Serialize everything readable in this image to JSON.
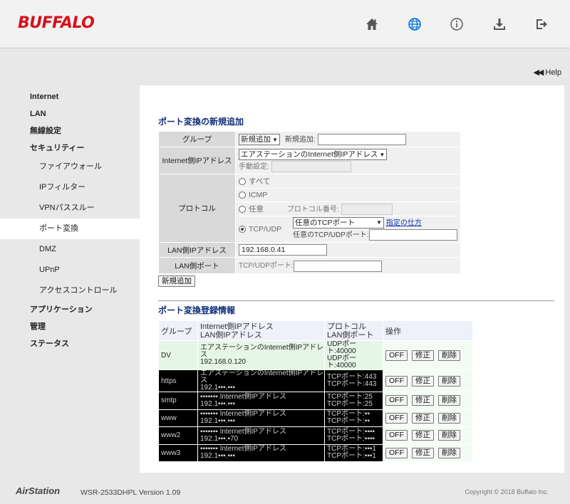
{
  "header": {
    "logo": "BUFFALO",
    "icons": [
      "home-icon",
      "globe-icon",
      "info-icon",
      "download-icon",
      "logout-icon"
    ],
    "active_icon_color": "#1a7fd6",
    "brand_color": "#d6111b"
  },
  "help": {
    "arrows": "◀◀",
    "label": "Help"
  },
  "sidebar": {
    "internet": "Internet",
    "lan": "LAN",
    "wireless": "無線設定",
    "security": "セキュリティー",
    "firewall": "ファイアウォール",
    "ipfilter": "IPフィルター",
    "vpn": "VPNパススルー",
    "portforward": "ポート変換",
    "dmz": "DMZ",
    "upnp": "UPnP",
    "access": "アクセスコントロール",
    "application": "アプリケーション",
    "admin": "管理",
    "status": "ステータス"
  },
  "add_section": {
    "title": "ポート変換の新規追加",
    "group_label": "グループ",
    "group_select": "新規追加",
    "group_new_label": "新規追加:",
    "internet_ip_label": "Internet側IPアドレス",
    "internet_ip_select": "エアステーションのInternet側IPアドレス",
    "manual_label": "手動設定:",
    "protocol_label": "プロトコル",
    "proto_all": "すべて",
    "proto_icmp": "ICMP",
    "proto_any": "任意",
    "proto_number_label": "プロトコル番号:",
    "proto_tcpudp": "TCP/UDP",
    "tcp_select": "任意のTCPポート",
    "howto_link": "指定の仕方",
    "any_port_label": "任意のTCP/UDPポート:",
    "lan_ip_label": "LAN側IPアドレス",
    "lan_ip_value": "192.168.0.41",
    "lan_port_label": "LAN側ポート",
    "lan_port_prefix": "TCP/UDPポート:",
    "add_button": "新規追加"
  },
  "list_section": {
    "title": "ポート変換登録情報",
    "headers": {
      "group": "グループ",
      "addr1": "Internet側IPアドレス",
      "addr2": "LAN側IPアドレス",
      "proto1": "プロトコル",
      "proto2": "LAN側ポート",
      "ops": "操作"
    },
    "rows": [
      {
        "group": "DV",
        "addr1": "エアステーションのInternet側IPアドレス",
        "addr2": "192.168.0.120",
        "proto1": "UDPポート:40000",
        "proto2": "UDPポート:40000",
        "style": "green"
      },
      {
        "group": "https",
        "addr1": "エアステーションのInternet側IPアドレス",
        "addr2": "192.1▪▪▪.▪▪▪",
        "proto1": "TCPポート:443",
        "proto2": "TCPポート:443",
        "style": "dark"
      },
      {
        "group": "smtp",
        "addr1": "▪▪▪▪▪▪▪ Internet側IPアドレス",
        "addr2": "192.1▪▪▪.▪▪▪",
        "proto1": "TCPポート:25",
        "proto2": "TCPポート:25",
        "style": "dark"
      },
      {
        "group": "www",
        "addr1": "▪▪▪▪▪▪▪ Internet側IPアドレス",
        "addr2": "192.1▪▪▪.▪▪▪",
        "proto1": "TCPポート:▪▪",
        "proto2": "TCPポート:▪▪",
        "style": "dark"
      },
      {
        "group": "www2",
        "addr1": "▪▪▪▪▪▪▪ Internet側IPアドレス",
        "addr2": "192.1▪▪▪.▪70",
        "proto1": "TCPポート:▪▪▪▪",
        "proto2": "TCPポート:▪▪▪▪",
        "style": "dark"
      },
      {
        "group": "www3",
        "addr1": "▪▪▪▪▪▪▪ Internet側IPアドレス",
        "addr2": "192.1▪▪▪.▪▪▪",
        "proto1": "TCPポート:▪▪▪1",
        "proto2": "TCPポート:▪▪▪1",
        "style": "dark"
      }
    ],
    "btn_off": "OFF",
    "btn_edit": "修正",
    "btn_delete": "削除"
  },
  "footer": {
    "brand": "AirStation",
    "model": "WSR-2533DHPL  Version 1.09",
    "copyright": "Copyright © 2018 Buffalo Inc."
  }
}
